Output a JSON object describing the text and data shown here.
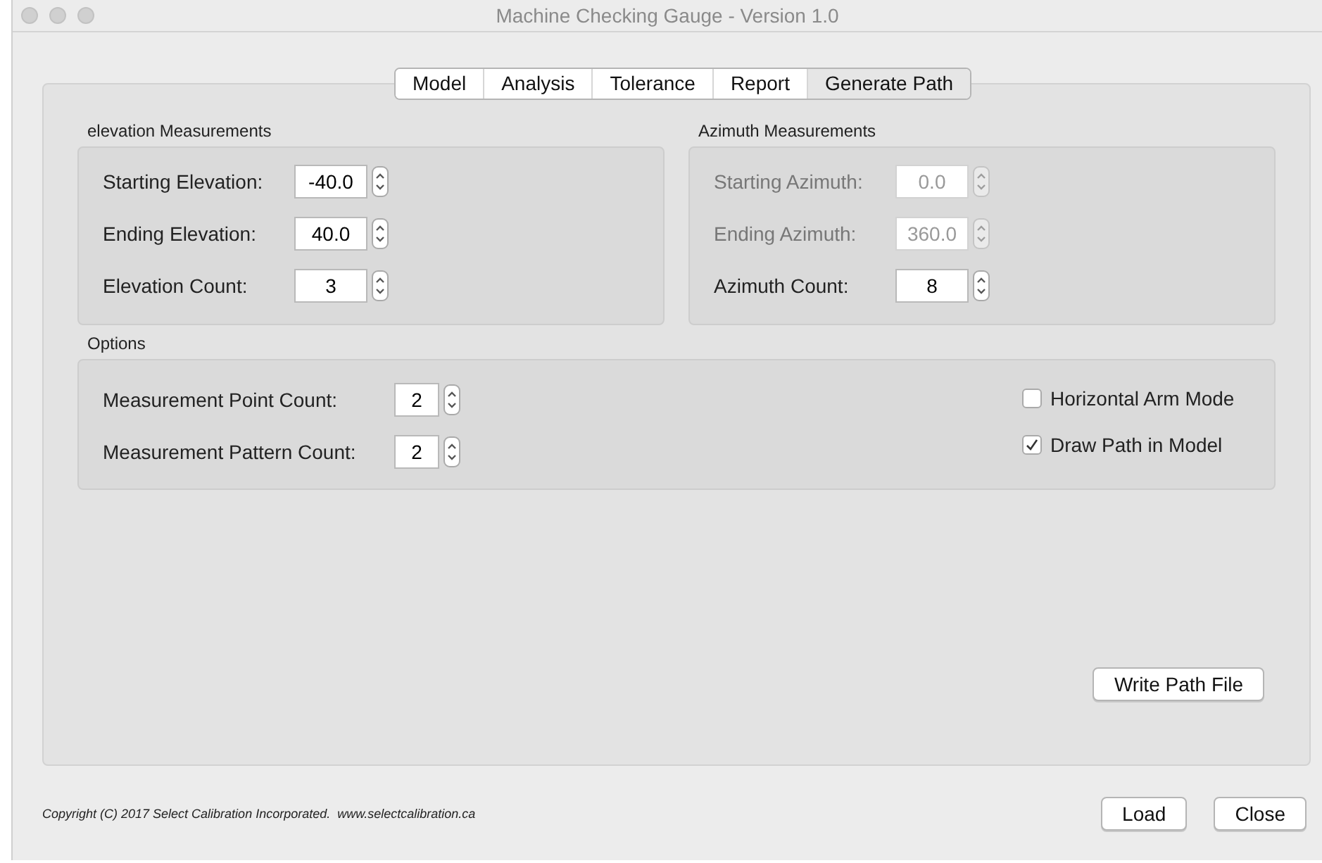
{
  "window": {
    "title": "Machine Checking Gauge - Version 1.0"
  },
  "tabs": [
    {
      "label": "Model",
      "selected": false
    },
    {
      "label": "Analysis",
      "selected": false
    },
    {
      "label": "Tolerance",
      "selected": false
    },
    {
      "label": "Report",
      "selected": false
    },
    {
      "label": "Generate Path",
      "selected": true
    }
  ],
  "groups": [
    {
      "title": "elevation Measurements",
      "fields": [
        {
          "label": "Starting Elevation:",
          "value": "-40.0",
          "disabled": false
        },
        {
          "label": "Ending Elevation:",
          "value": "40.0",
          "disabled": false
        },
        {
          "label": "Elevation Count:",
          "value": "3",
          "disabled": false
        }
      ]
    },
    {
      "title": "Azimuth Measurements",
      "fields": [
        {
          "label": "Starting Azimuth:",
          "value": "0.0",
          "disabled": true
        },
        {
          "label": "Ending Azimuth:",
          "value": "360.0",
          "disabled": true
        },
        {
          "label": "Azimuth Count:",
          "value": "8",
          "disabled": false
        }
      ]
    }
  ],
  "options": {
    "title": "Options",
    "fields": [
      {
        "label": "Measurement Point Count:",
        "value": "2",
        "disabled": false
      },
      {
        "label": "Measurement Pattern Count:",
        "value": "2",
        "disabled": false
      }
    ],
    "checkboxes": [
      {
        "label": "Horizontal Arm Mode",
        "checked": false
      },
      {
        "label": "Draw Path in Model",
        "checked": true
      }
    ]
  },
  "write_button": "Write Path File",
  "footer": {
    "copyright": "Copyright (C) 2017 Select Calibration Incorporated.  www.selectcalibration.ca",
    "buttons": [
      "Load",
      "Close"
    ]
  }
}
